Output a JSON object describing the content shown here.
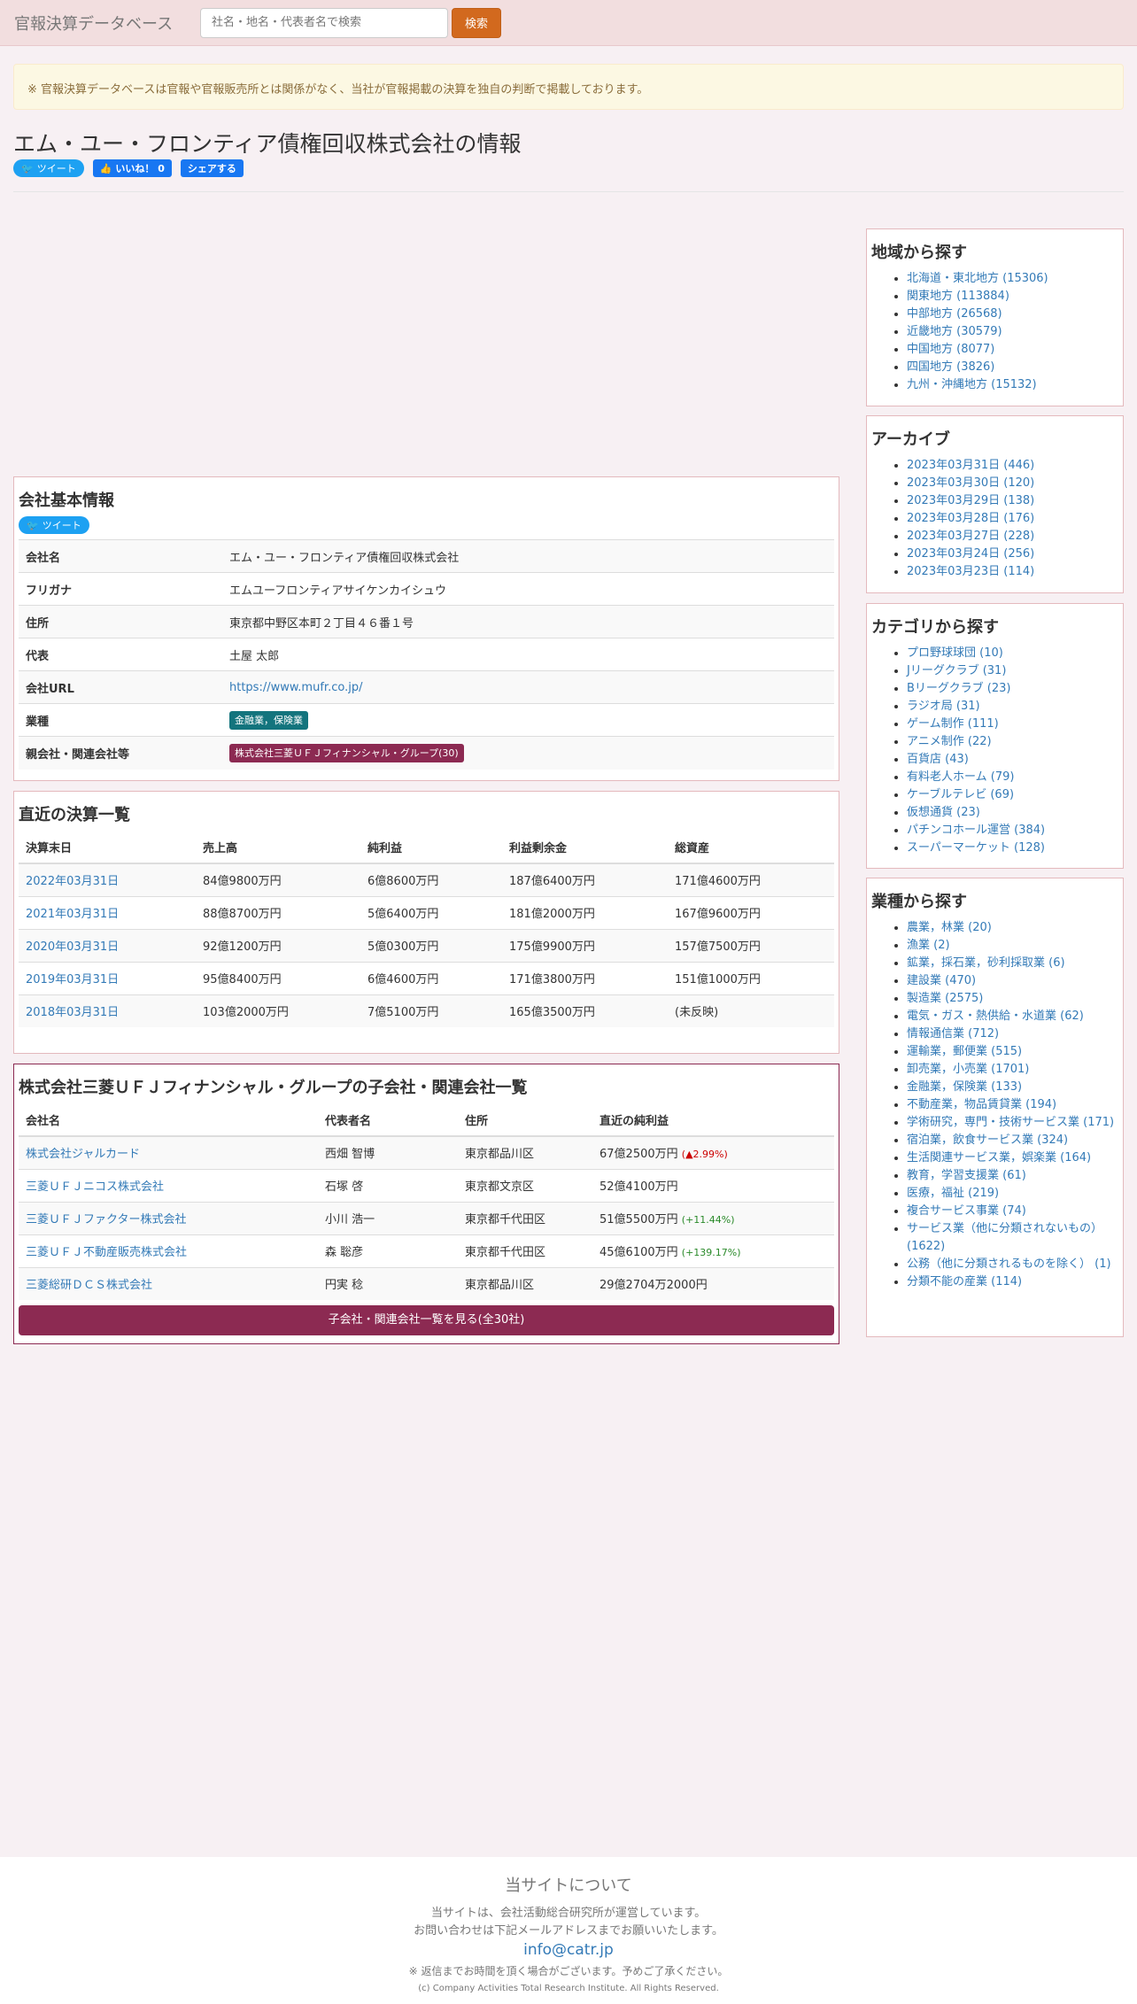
{
  "nav": {
    "brand": "官報決算データベース",
    "search_placeholder": "社名・地名・代表者名で検索",
    "search_button": "検索"
  },
  "notice": "※ 官報決算データベースは官報や官報販売所とは関係がなく、当社が官報掲載の決算を独自の判断で掲載しております。",
  "page_title": "エム・ユー・フロンティア債権回収株式会社の情報",
  "social": {
    "tweet": "ツイート",
    "like": "いいね！ 0",
    "share": "シェアする"
  },
  "basic": {
    "title": "会社基本情報",
    "tweet": "ツイート",
    "rows": [
      {
        "label": "会社名",
        "value": "エム・ユー・フロンティア債権回収株式会社"
      },
      {
        "label": "フリガナ",
        "value": "エムユーフロンティアサイケンカイシュウ"
      },
      {
        "label": "住所",
        "value": "東京都中野区本町２丁目４６番１号"
      },
      {
        "label": "代表",
        "value": "土屋 太郎"
      },
      {
        "label": "会社URL",
        "value": "https://www.mufr.co.jp/"
      },
      {
        "label": "業種",
        "value": "金融業，保険業"
      },
      {
        "label": "親会社・関連会社等",
        "value": "株式会社三菱ＵＦＪフィナンシャル・グループ(30)"
      }
    ]
  },
  "settlements": {
    "title": "直近の決算一覧",
    "headers": [
      "決算末日",
      "売上高",
      "純利益",
      "利益剰余金",
      "総資産"
    ],
    "rows": [
      [
        "2022年03月31日",
        "84億9800万円",
        "6億8600万円",
        "187億6400万円",
        "171億4600万円"
      ],
      [
        "2021年03月31日",
        "88億8700万円",
        "5億6400万円",
        "181億2000万円",
        "167億9600万円"
      ],
      [
        "2020年03月31日",
        "92億1200万円",
        "5億0300万円",
        "175億9900万円",
        "157億7500万円"
      ],
      [
        "2019年03月31日",
        "95億8400万円",
        "6億4600万円",
        "171億3800万円",
        "151億1000万円"
      ],
      [
        "2018年03月31日",
        "103億2000万円",
        "7億5100万円",
        "165億3500万円",
        "(未反映)"
      ]
    ]
  },
  "group": {
    "title": "株式会社三菱ＵＦＪフィナンシャル・グループの子会社・関連会社一覧",
    "headers": [
      "会社名",
      "代表者名",
      "住所",
      "直近の純利益"
    ],
    "rows": [
      {
        "name": "株式会社ジャルカード",
        "rep": "西畑 智博",
        "addr": "東京都品川区",
        "profit": "67億2500万円",
        "change": "▲2.99%",
        "change_type": "down"
      },
      {
        "name": "三菱ＵＦＪニコス株式会社",
        "rep": "石塚 啓",
        "addr": "東京都文京区",
        "profit": "52億4100万円",
        "change": "",
        "change_type": ""
      },
      {
        "name": "三菱ＵＦＪファクター株式会社",
        "rep": "小川 浩一",
        "addr": "東京都千代田区",
        "profit": "51億5500万円",
        "change": "+11.44%",
        "change_type": "up"
      },
      {
        "name": "三菱ＵＦＪ不動産販売株式会社",
        "rep": "森 聡彦",
        "addr": "東京都千代田区",
        "profit": "45億6100万円",
        "change": "+139.17%",
        "change_type": "up"
      },
      {
        "name": "三菱総研ＤＣＳ株式会社",
        "rep": "円実 稔",
        "addr": "東京都品川区",
        "profit": "29億2704万2000円",
        "change": "",
        "change_type": ""
      }
    ],
    "more_button": "子会社・関連会社一覧を見る(全30社)"
  },
  "sidebar": {
    "region": {
      "title": "地域から探す",
      "items": [
        "北海道・東北地方 (15306)",
        "関東地方 (113884)",
        "中部地方 (26568)",
        "近畿地方 (30579)",
        "中国地方 (8077)",
        "四国地方 (3826)",
        "九州・沖縄地方 (15132)"
      ]
    },
    "archive": {
      "title": "アーカイブ",
      "items": [
        "2023年03月31日 (446)",
        "2023年03月30日 (120)",
        "2023年03月29日 (138)",
        "2023年03月28日 (176)",
        "2023年03月27日 (228)",
        "2023年03月24日 (256)",
        "2023年03月23日 (114)"
      ]
    },
    "category": {
      "title": "カテゴリから探す",
      "items": [
        "プロ野球球団 (10)",
        "Jリーグクラブ (31)",
        "Bリーグクラブ (23)",
        "ラジオ局 (31)",
        "ゲーム制作 (111)",
        "アニメ制作 (22)",
        "百貨店 (43)",
        "有料老人ホーム (79)",
        "ケーブルテレビ (69)",
        "仮想通貨 (23)",
        "パチンコホール運営 (384)",
        "スーパーマーケット (128)"
      ]
    },
    "industry": {
      "title": "業種から探す",
      "items": [
        "農業，林業 (20)",
        "漁業 (2)",
        "鉱業，採石業，砂利採取業 (6)",
        "建設業 (470)",
        "製造業 (2575)",
        "電気・ガス・熱供給・水道業 (62)",
        "情報通信業 (712)",
        "運輸業，郵便業 (515)",
        "卸売業，小売業 (1701)",
        "金融業，保険業 (133)",
        "不動産業，物品賃貸業 (194)",
        "学術研究，専門・技術サービス業 (171)",
        "宿泊業，飲食サービス業 (324)",
        "生活関連サービス業，娯楽業 (164)",
        "教育，学習支援業 (61)",
        "医療，福祉 (219)",
        "複合サービス事業 (74)",
        "サービス業（他に分類されないもの） (1622)",
        "公務（他に分類されるものを除く） (1)",
        "分類不能の産業 (114)"
      ]
    }
  },
  "footer": {
    "title": "当サイトについて",
    "line1": "当サイトは、会社活動総合研究所が運営しています。",
    "line2": "お問い合わせは下記メールアドレスまでお願いいたします。",
    "email": "info@catr.jp",
    "note": "※ 返信までお時間を頂く場合がございます。予めご了承ください。",
    "copyright": "(c) Company Activities Total Research Institute. All Rights Reserved."
  }
}
